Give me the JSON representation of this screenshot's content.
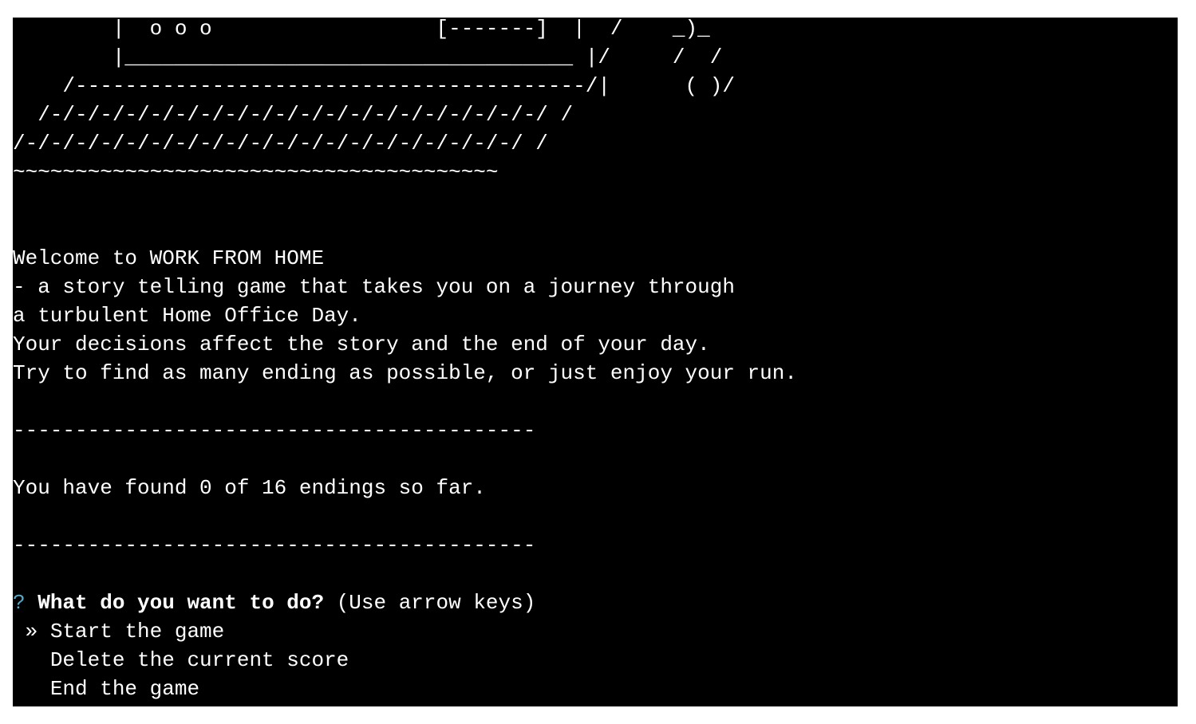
{
  "ascii_art": [
    "        |  o o o                  [-------]  |  /    _)_",
    "        |____________________________________ |/     /  /",
    "    /-----------------------------------------/|      ( )/",
    "  /-/-/-/-/-/-/-/-/-/-/-/-/-/-/-/-/-/-/-/-/ /",
    "/-/-/-/-/-/-/-/-/-/-/-/-/-/-/-/-/-/-/-/-/ /",
    "~~~~~~~~~~~~~~~~~~~~~~~~~~~~~~~~~~~~~~~"
  ],
  "intro": [
    "Welcome to WORK FROM HOME",
    "- a story telling game that takes you on a journey through",
    "a turbulent Home Office Day.",
    "Your decisions affect the story and the end of your day.",
    "Try to find as many ending as possible, or just enjoy your run."
  ],
  "separator": "------------------------------------------",
  "score_text": "You have found 0 of 16 endings so far.",
  "prompt": {
    "symbol": "?",
    "question": "What do you want to do?",
    "hint": "(Use arrow keys)"
  },
  "menu": {
    "pointer": "»",
    "options": [
      "Start the game",
      "Delete the current score",
      "End the game"
    ]
  },
  "colors": {
    "background": "#000000",
    "text": "#ffffff",
    "prompt_symbol": "#5aa7c7"
  }
}
